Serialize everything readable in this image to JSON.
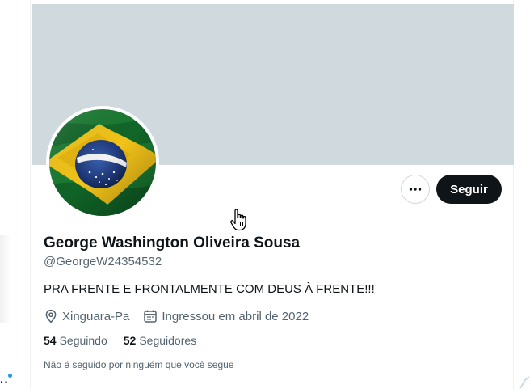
{
  "profile": {
    "display_name": "George Washington Oliveira Sousa",
    "handle": "@GeorgeW24354532",
    "bio": "PRA FRENTE E FRONTALMENTE COM DEUS À FRENTE!!!",
    "location": "Xinguara-Pa",
    "joined": "Ingressou em abril de 2022",
    "following_count": "54",
    "following_label": "Seguindo",
    "followers_count": "52",
    "followers_label": "Seguidores",
    "not_followed_note": "Não é seguido por ninguém que você segue"
  },
  "actions": {
    "follow_label": "Seguir"
  },
  "icons": {
    "more": "more-icon",
    "location": "location-pin-icon",
    "calendar": "calendar-icon",
    "cursor": "hand-cursor-icon"
  },
  "colors": {
    "banner": "#cfd9de",
    "text_primary": "#0f1419",
    "text_secondary": "#536471",
    "follow_button_bg": "#0f1419",
    "accent_dot": "#1d9bf0"
  }
}
